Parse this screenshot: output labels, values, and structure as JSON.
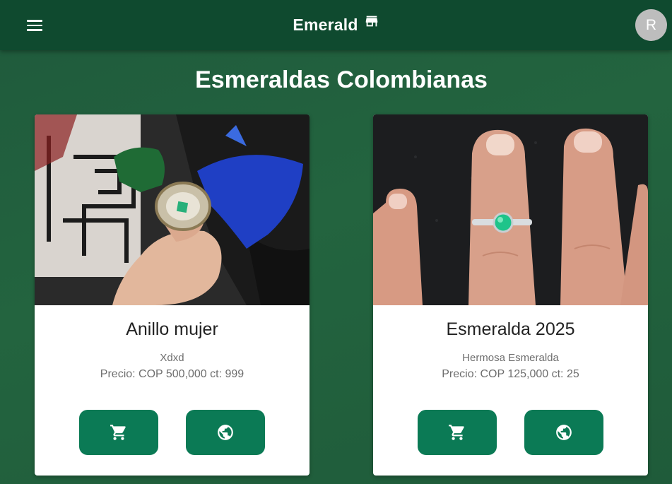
{
  "appbar": {
    "title": "Emerald",
    "avatar_letter": "R",
    "menu_icon": "menu-icon",
    "brand_icon": "store-icon"
  },
  "page": {
    "title": "Esmeraldas Colombianas"
  },
  "products": [
    {
      "name": "Anillo mujer",
      "description": "Xdxd",
      "price_line": "Precio: COP 500,000 ct: 999",
      "image": "ring-photo-hand-holding-emerald-ring",
      "cart_icon": "cart-icon",
      "web_icon": "globe-icon"
    },
    {
      "name": "Esmeralda 2025",
      "description": "Hermosa Esmeralda",
      "price_line": "Precio: COP 125,000 ct: 25",
      "image": "ring-photo-emerald-ring-on-finger",
      "cart_icon": "cart-icon",
      "web_icon": "globe-icon"
    }
  ],
  "colors": {
    "appbar": "#0f4a2f",
    "background": "#23643f",
    "button": "#0b7a55",
    "avatar": "#bdbdbd"
  }
}
